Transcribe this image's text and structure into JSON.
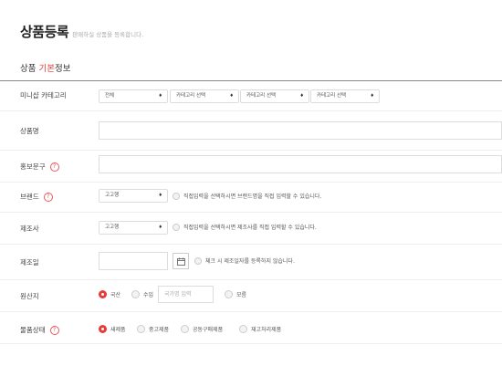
{
  "header": {
    "title": "상품등록",
    "description": "판매하실 상품을 등록합니다."
  },
  "section": {
    "title_prefix": "상품 ",
    "title_highlight": "기본",
    "title_suffix": "정보"
  },
  "category": {
    "label": "미니샵 카테고리",
    "selects": [
      "전체",
      "카테고리 선택",
      "카테고리 선택",
      "카테고리 선택"
    ]
  },
  "product_name": {
    "label": "상품명",
    "value": ""
  },
  "promo": {
    "label": "홍보문구",
    "value": ""
  },
  "brand": {
    "label": "브랜드",
    "select": "고고행",
    "check_label": "직접입력을 선택하시면 브랜드명을 직접 입력할 수 있습니다."
  },
  "maker": {
    "label": "제조사",
    "select": "고고행",
    "check_label": "직접입력을 선택하시면 제조사를 직접 입력할 수 있습니다."
  },
  "made_date": {
    "label": "제조일",
    "value": "",
    "check_label": "체크 시 제조일자를 등록하지 않습니다."
  },
  "origin": {
    "label": "원산지",
    "options": [
      "국산",
      "수입",
      "모름"
    ],
    "selected": "국산",
    "country_placeholder": "국가명 입력"
  },
  "condition": {
    "label": "물품상태",
    "options": [
      "새제품",
      "중고제품",
      "공동구매제품",
      "재고처리제품"
    ],
    "selected": "새제품"
  },
  "help_icon_char": "?"
}
